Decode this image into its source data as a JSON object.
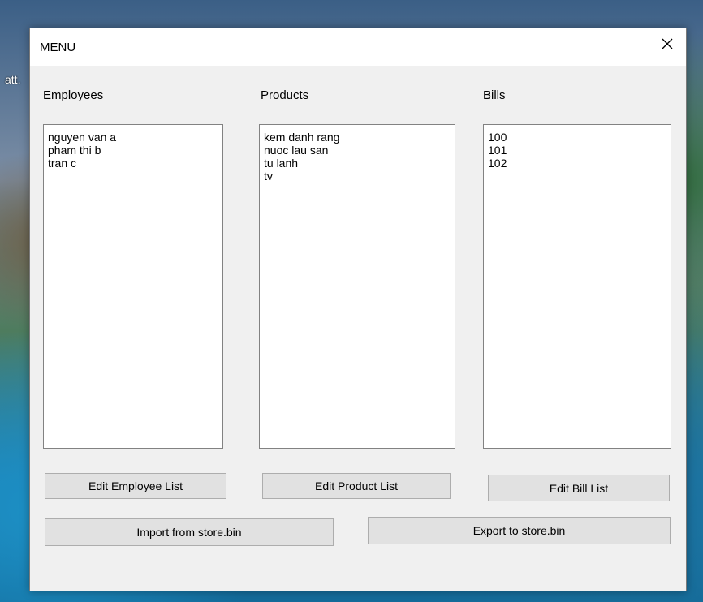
{
  "desktop": {
    "partial_text": "att."
  },
  "window": {
    "title": "MENU"
  },
  "employees": {
    "label": "Employees",
    "items": [
      "nguyen van a",
      "pham thi b",
      "tran c"
    ],
    "edit_button": "Edit Employee List"
  },
  "products": {
    "label": "Products",
    "items": [
      "kem danh rang",
      "nuoc lau san",
      "tu lanh",
      "tv"
    ],
    "edit_button": "Edit Product List"
  },
  "bills": {
    "label": "Bills",
    "items": [
      "100",
      "101",
      "102"
    ],
    "edit_button": "Edit Bill List"
  },
  "actions": {
    "import_button": "Import from store.bin",
    "export_button": "Export to store.bin"
  },
  "icons": {
    "close": "close-icon"
  }
}
